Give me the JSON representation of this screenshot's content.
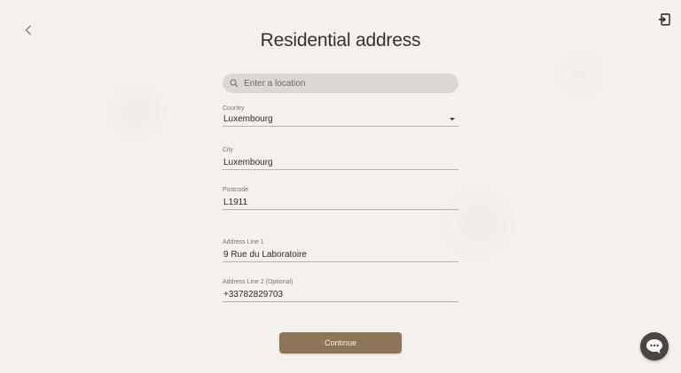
{
  "header": {
    "title": "Residential address"
  },
  "icons": {
    "back": "chevron-left-icon",
    "logout": "logout-icon",
    "search": "search-icon",
    "chat": "chat-icon"
  },
  "search": {
    "placeholder": "Enter a location",
    "value": ""
  },
  "fields": {
    "country": {
      "label": "Country",
      "value": "Luxembourg"
    },
    "city": {
      "label": "City",
      "value": "Luxembourg"
    },
    "postcode": {
      "label": "Postcode",
      "value": "L1911"
    },
    "address1": {
      "label": "Address Line 1",
      "value": "9 Rue du Laboratoire"
    },
    "address2": {
      "label": "Address Line 2 (Optional)",
      "value": "+33782829703"
    }
  },
  "actions": {
    "continue_label": "Continue"
  },
  "colors": {
    "background": "#f4f1ec",
    "accent": "#8d7658",
    "text": "#3a3028",
    "search_bg": "#dcd8d1",
    "chat_bg": "#4a4442"
  }
}
